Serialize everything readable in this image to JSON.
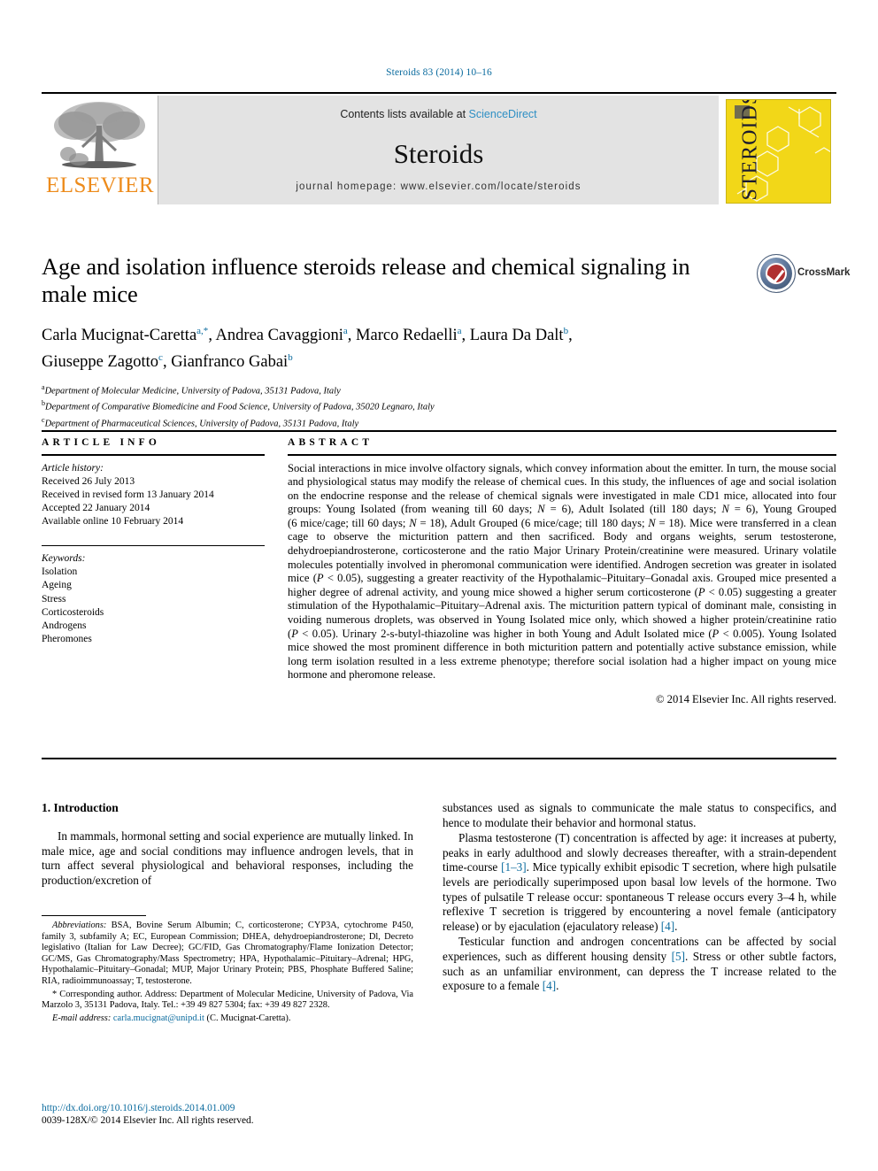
{
  "running_head": "Steroids 83 (2014) 10–16",
  "masthead": {
    "publisher_name": "ELSEVIER",
    "contents_prefix": "Contents lists available at ",
    "contents_link": "ScienceDirect",
    "journal_title": "Steroids",
    "homepage": "journal homepage: www.elsevier.com/locate/steroids",
    "cover_title": "STEROIDS"
  },
  "article": {
    "title": "Age and isolation influence steroids release and chemical signaling in male mice",
    "authors_line_1_parts": [
      {
        "text": "Carla Mucignat-Caretta",
        "sup": "a,*"
      },
      {
        "text": "Andrea Cavaggioni",
        "sup": "a"
      },
      {
        "text": "Marco Redaelli",
        "sup": "a"
      },
      {
        "text": "Laura Da Dalt",
        "sup": "b"
      }
    ],
    "authors_line_2_parts": [
      {
        "text": "Giuseppe Zagotto",
        "sup": "c"
      },
      {
        "text": "Gianfranco Gabai",
        "sup": "b"
      }
    ],
    "affiliations": [
      {
        "mark": "a",
        "text": "Department of Molecular Medicine, University of Padova, 35131 Padova, Italy"
      },
      {
        "mark": "b",
        "text": "Department of Comparative Biomedicine and Food Science, University of Padova, 35020 Legnaro, Italy"
      },
      {
        "mark": "c",
        "text": "Department of Pharmaceutical Sciences, University of Padova, 35131 Padova, Italy"
      }
    ],
    "crossmark_label": "CrossMark"
  },
  "article_info": {
    "heading": "ARTICLE INFO",
    "history_title": "Article history:",
    "history": [
      "Received 26 July 2013",
      "Received in revised form 13 January 2014",
      "Accepted 22 January 2014",
      "Available online 10 February 2014"
    ],
    "keywords_title": "Keywords:",
    "keywords": [
      "Isolation",
      "Ageing",
      "Stress",
      "Corticosteroids",
      "Androgens",
      "Pheromones"
    ]
  },
  "abstract": {
    "heading": "ABSTRACT",
    "body_html": "Social interactions in mice involve olfactory signals, which convey information about the emitter. In turn, the mouse social and physiological status may modify the release of chemical cues. In this study, the influences of age and social isolation on the endocrine response and the release of chemical signals were investigated in male CD1 mice, allocated into four groups: Young Isolated (from weaning till 60&nbsp;days; <i>N</i>&nbsp;=&nbsp;6), Adult Isolated (till 180&nbsp;days; <i>N</i>&nbsp;=&nbsp;6), Young Grouped (6&nbsp;mice/cage; till 60&nbsp;days; <i>N</i>&nbsp;=&nbsp;18), Adult Grouped (6&nbsp;mice/cage; till 180&nbsp;days; <i>N</i>&nbsp;=&nbsp;18). Mice were transferred in a clean cage to observe the micturition pattern and then sacrificed. Body and organs weights, serum testosterone, dehydroepiandrosterone, corticosterone and the ratio Major Urinary Protein/creatinine were measured. Urinary volatile molecules potentially involved in pheromonal communication were identified. Androgen secretion was greater in isolated mice (<i>P</i>&nbsp;&lt;&nbsp;0.05), suggesting a greater reactivity of the Hypothalamic–Pituitary–Gonadal axis. Grouped mice presented a higher degree of adrenal activity, and young mice showed a higher serum corticosterone (<i>P</i>&nbsp;&lt;&nbsp;0.05) suggesting a greater stimulation of the Hypothalamic–Pituitary–Adrenal axis. The micturition pattern typical of dominant male, consisting in voiding numerous droplets, was observed in Young Isolated mice only, which showed a higher protein/creatinine ratio (<i>P</i>&nbsp;&lt;&nbsp;0.05). Urinary 2-s-butyl-thiazoline was higher in both Young and Adult Isolated mice (<i>P</i>&nbsp;&lt;&nbsp;0.005). Young Isolated mice showed the most prominent difference in both micturition pattern and potentially active substance emission, while long term isolation resulted in a less extreme phenotype; therefore social isolation had a higher impact on young mice hormone and pheromone release.",
    "copyright": "© 2014 Elsevier Inc. All rights reserved."
  },
  "introduction": {
    "heading": "1. Introduction",
    "left_paragraphs": [
      "In mammals, hormonal setting and social experience are mutually linked. In male mice, age and social conditions may influence androgen levels, that in turn affect several physiological and behavioral responses, including the production/excretion of"
    ],
    "right_paragraphs_html": [
      "substances used as signals to communicate the male status to conspecifics, and hence to modulate their behavior and hormonal status.",
      "Plasma testosterone (T) concentration is affected by age: it increases at puberty, peaks in early adulthood and slowly decreases thereafter, with a strain-dependent time-course <span class=\"ref\">[1–3]</span>. Mice typically exhibit episodic T secretion, where high pulsatile levels are periodically superimposed upon basal low levels of the hormone. Two types of pulsatile T release occur: spontaneous T release occurs every 3–4&nbsp;h, while reflexive T secretion is triggered by encountering a novel female (anticipatory release) or by ejaculation (ejaculatory release) <span class=\"ref\">[4]</span>.",
      "Testicular function and androgen concentrations can be affected by social experiences, such as different housing density <span class=\"ref\">[5]</span>. Stress or other subtle factors, such as an unfamiliar environment, can depress the T increase related to the exposure to a female <span class=\"ref\">[4]</span>."
    ]
  },
  "footnotes": {
    "abbreviations_html": "<i>Abbreviations:</i> BSA, Bovine Serum Albumin; C, corticosterone; CYP3A, cytochrome P450, family 3, subfamily A; EC, European Commission; DHEA, dehydroepiandrosterone; Dl, Decreto legislativo (Italian for Law Decree); GC/FID, Gas Chromatography/Flame Ionization Detector; GC/MS, Gas Chromatography/Mass Spectrometry; HPA, Hypothalamic–Pituitary–Adrenal; HPG, Hypothalamic–Pituitary–Gonadal; MUP, Major Urinary Protein; PBS, Phosphate Buffered Saline; RIA, radioimmunoassay; T, testosterone.",
    "corresponding_html": "* Corresponding author. Address: Department of Molecular Medicine, University of Padova, Via Marzolo 3, 35131 Padova, Italy. Tel.: +39 49 827 5304; fax: +39 49 827 2328.",
    "email_html": "<i>E-mail address:</i> <span class=\"link\">carla.mucignat@unipd.it</span> (C. Mucignat-Caretta)."
  },
  "footer": {
    "doi": "http://dx.doi.org/10.1016/j.steroids.2014.01.009",
    "issn": "0039-128X/© 2014 Elsevier Inc. All rights reserved."
  }
}
